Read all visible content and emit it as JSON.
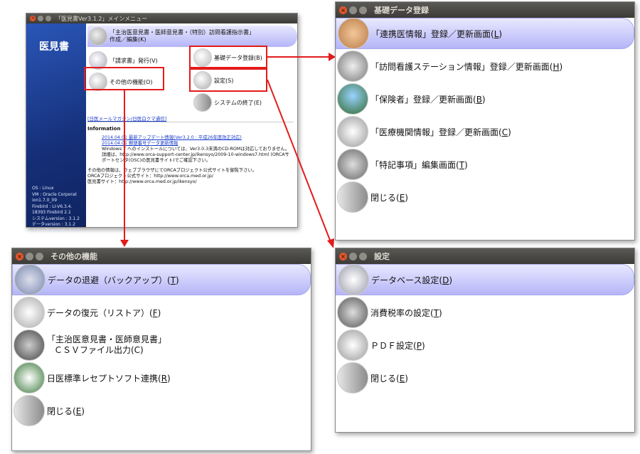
{
  "main": {
    "title": "「医見書Ver3.1.2」メインメニュー",
    "logo": "医見書",
    "menu": [
      {
        "label": "「主治医意見書・医師意見書・（特別）訪問看護指示書」",
        "label2": "作成／編集(K)"
      },
      {
        "label": "「請求書」発行(V)"
      },
      {
        "label": "基礎データ登録(B)"
      },
      {
        "label": "その他の機能(O)"
      },
      {
        "label": "設定(S)"
      },
      {
        "label": "システムの終了(E)"
      }
    ],
    "link": "[日医メールマガジン/日医白クマ通信]",
    "info_title": "Information",
    "info_items": [
      "2014.04.01 最新アップデート情報(Ver3.2.0 : 平成26年度改正対応)",
      "2014.04.01 郵便番号データ更新情報",
      "Windows 7 へのインストールについては、Ver3.0.3未満のCD-ROMは対応しておりません。詳細は、http://www.orca-support-center.jp/ikensyo/2009-10-windows7.html (ORCAサポートセンタ(OSC)の医見書サイト)でご確認下さい。"
    ],
    "info_footer": [
      "その他の情報は、ウェブブラウザにてORCAプロジェクト公式サイトを御覧下さい。",
      "ORCAプロジェクト公式サイト：http://www.orca.med.or.jp/",
      "医見書サイト：http://www.orca.med.or.jp/ikensyo/"
    ],
    "sysinfo": [
      "OS : Linux",
      "VM : Oracle Corporat",
      "ion1.7.0_09",
      "Firebird : LI-V6.3.4.",
      "18393 Firebird 2.1",
      "システムversion : 3.1.2",
      "データversion : 3.1.2",
      "スキーマversion : 3.1.2"
    ]
  },
  "kiso": {
    "title": "基礎データ登録",
    "items": [
      {
        "label": "「連携医情報」登録／更新画面(",
        "key": "L",
        "end": ")"
      },
      {
        "label": "「訪問看護ステーション情報」登録／更新画面(",
        "key": "H",
        "end": ")"
      },
      {
        "label": "「保険者」登録／更新画面(",
        "key": "B",
        "end": ")"
      },
      {
        "label": "「医療機関情報」登録／更新画面(",
        "key": "C",
        "end": ")"
      },
      {
        "label": "「特記事項」編集画面(",
        "key": "T",
        "end": ")"
      },
      {
        "label": "閉じる(",
        "key": "E",
        "end": ")"
      }
    ]
  },
  "other": {
    "title": "その他の機能",
    "items": [
      {
        "label": "データの退避（バックアップ）(",
        "key": "T",
        "end": ")"
      },
      {
        "label": "データの復元（リストア）(",
        "key": "F",
        "end": ")"
      },
      {
        "label": "「主治医意見書・医師意見書」",
        "label2": "ＣＳＶファイル出力(C)"
      },
      {
        "label": "日医標準レセプトソフト連携(",
        "key": "R",
        "end": ")"
      },
      {
        "label": "閉じる(",
        "key": "E",
        "end": ")"
      }
    ]
  },
  "settei": {
    "title": "設定",
    "items": [
      {
        "label": "データベース設定(",
        "key": "D",
        "end": ")"
      },
      {
        "label": "消費税率の設定(",
        "key": "T",
        "end": ")"
      },
      {
        "label": "ＰＤＦ設定(",
        "key": "P",
        "end": ")"
      },
      {
        "label": "閉じる(",
        "key": "E",
        "end": ")"
      }
    ]
  },
  "colors": {
    "accent": "#e41b1b",
    "highlight": "#b5b5f8",
    "sidebar": "#1d3f93"
  }
}
